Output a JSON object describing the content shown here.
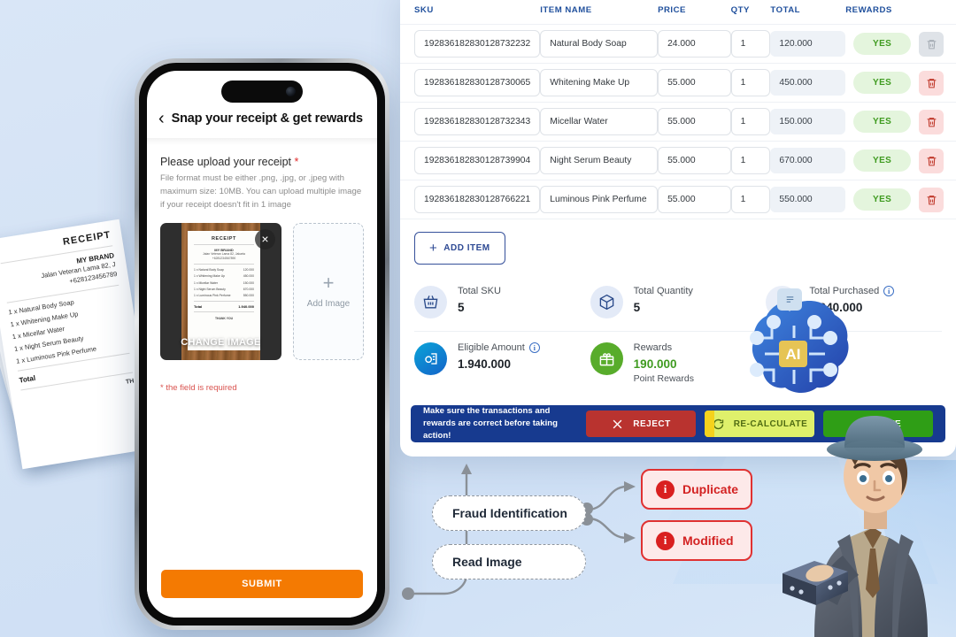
{
  "phone": {
    "header_title": "Snap your receipt & get rewards",
    "back_icon": "chevron-left-icon",
    "upload_label": "Please upload your receipt",
    "required_mark": "*",
    "upload_desc": "File format must be either .png, .jpg, or .jpeg with maximum size: 10MB. You can upload multiple image if your receipt doesn't fit in 1 image",
    "change_image_label": "CHANGE IMAGE",
    "close_label": "×",
    "add_image_label": "Add Image",
    "add_image_plus": "+",
    "field_required": "* the field is required",
    "submit_label": "SUBMIT",
    "thumb_receipt": {
      "title": "RECEIPT",
      "brand": "MY BRAND",
      "address": "Jalan Veteran Lama 82, Jakarta",
      "phone": "+6281234567890",
      "lines": [
        {
          "name": "1 x Natural Body Soap",
          "amount": "120.000"
        },
        {
          "name": "1 x Whitening Make Up",
          "amount": "450.000"
        },
        {
          "name": "1 x Micellar Water",
          "amount": "150.000"
        },
        {
          "name": "1 x Night Serum Beauty",
          "amount": "670.000"
        },
        {
          "name": "1 x Luminous Pink Perfume",
          "amount": "550.000"
        }
      ],
      "total_label": "Total",
      "total_value": "1.940.000",
      "thanks": "THANK YOU"
    }
  },
  "paper_receipt": {
    "title": "RECEIPT",
    "brand": "MY BRAND",
    "address": "Jalan Veteran Lama 82, J",
    "phone": "+628123456789",
    "lines": [
      "1 x Natural Body Soap",
      "1 x Whitening Make Up",
      "1 x Micellar Water",
      "1 x Night Serum Beauty",
      "1 x Luminous Pink Perfume"
    ],
    "total_label": "Total",
    "thanks": "TH"
  },
  "table": {
    "headers": [
      "SKU",
      "ITEM NAME",
      "PRICE",
      "QTY",
      "TOTAL",
      "REWARDS"
    ],
    "rows": [
      {
        "sku": "192836182830128732232",
        "name": "Natural Body Soap",
        "price": "24.000",
        "qty": "1",
        "total": "120.000",
        "rewards": "YES",
        "delete_enabled": false
      },
      {
        "sku": "192836182830128730065",
        "name": "Whitening Make Up",
        "price": "55.000",
        "qty": "1",
        "total": "450.000",
        "rewards": "YES",
        "delete_enabled": true
      },
      {
        "sku": "192836182830128732343",
        "name": "Micellar Water",
        "price": "55.000",
        "qty": "1",
        "total": "150.000",
        "rewards": "YES",
        "delete_enabled": true
      },
      {
        "sku": "192836182830128739904",
        "name": "Night Serum Beauty",
        "price": "55.000",
        "qty": "1",
        "total": "670.000",
        "rewards": "YES",
        "delete_enabled": true
      },
      {
        "sku": "192836182830128766221",
        "name": "Luminous Pink Perfume",
        "price": "55.000",
        "qty": "1",
        "total": "550.000",
        "rewards": "YES",
        "delete_enabled": true
      }
    ],
    "add_item_label": "ADD ITEM",
    "add_item_plus": "+"
  },
  "summary": {
    "total_sku_label": "Total SKU",
    "total_sku_value": "5",
    "total_qty_label": "Total Quantity",
    "total_qty_value": "5",
    "total_purchased_label": "Total Purchased",
    "total_purchased_value": "1.940.000",
    "eligible_label": "Eligible Amount",
    "eligible_value": "1.940.000",
    "rewards_label": "Rewards",
    "rewards_value": "190.000",
    "rewards_sub": "Point Rewards"
  },
  "action_bar": {
    "notice": "Make sure the transactions and rewards are correct before taking action!",
    "reject_label": "REJECT",
    "recalculate_label": "RE-CALCULATE",
    "approve_label": "APPROVE"
  },
  "flow": {
    "fraud_label": "Fraud Identification",
    "read_label": "Read Image",
    "duplicate_label": "Duplicate",
    "modified_label": "Modified",
    "alert_glyph": "i"
  },
  "brain": {
    "ai_label": "AI"
  },
  "colors": {
    "background": "#d6e4f5",
    "panel": "#ffffff",
    "header_blue": "#1f4f9c",
    "action_bar": "#173a8f",
    "reject": "#b9332f",
    "recalculate": "#dff06b",
    "approve": "#2f9e16",
    "submit_orange": "#f47a02",
    "reward_green": "#3f9b20",
    "alert_red": "#d32222",
    "required_red": "#d9534f"
  }
}
